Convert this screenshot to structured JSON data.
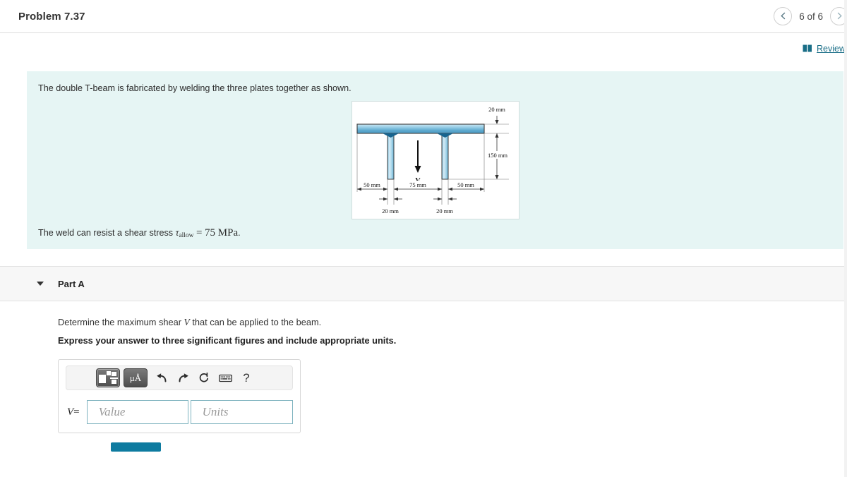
{
  "header": {
    "title": "Problem 7.37",
    "prev_icon": "chevron-left-icon",
    "next_icon": "chevron-right-icon",
    "pager_label": "6 of 6"
  },
  "review": {
    "icon": "book-icon",
    "label": "Review"
  },
  "statement": {
    "line1": "The double T-beam is fabricated by welding the three plates together as shown.",
    "line2_prefix": "The weld can resist a shear stress ",
    "line2_var": "τ",
    "line2_sub": "allow",
    "line2_eq": "=",
    "line2_value": "75 MPa",
    "line2_suffix": "."
  },
  "figure": {
    "caption_top": "20 mm",
    "caption_height": "150 mm",
    "dim_left": "50 mm",
    "dim_mid": "75 mm",
    "dim_right": "50 mm",
    "dim_web_left": "20 mm",
    "dim_web_right": "20 mm",
    "load_label": "V",
    "colors": {
      "flange_light": "#bfe0ef",
      "flange_mid": "#5fa9cf",
      "web_light": "#cfe6f2",
      "weld_dark": "#1a6a96",
      "outline": "#3b3b3b"
    }
  },
  "part": {
    "caret_icon": "chevron-down-icon",
    "label": "Part A",
    "question_prefix": "Determine the maximum shear ",
    "question_var": "V",
    "question_suffix": " that can be applied to the beam.",
    "instruction": "Express your answer to three significant figures and include appropriate units."
  },
  "answer": {
    "toolbar": [
      {
        "name": "template-button",
        "kind": "template",
        "label": ""
      },
      {
        "name": "units-button",
        "kind": "mu",
        "label": "μÅ"
      },
      {
        "name": "undo-icon",
        "kind": "icon",
        "label": "↩"
      },
      {
        "name": "redo-icon",
        "kind": "icon",
        "label": "↪"
      },
      {
        "name": "reset-icon",
        "kind": "icon",
        "label": "↺"
      },
      {
        "name": "keyboard-icon",
        "kind": "icon",
        "label": "⌨"
      },
      {
        "name": "help-icon",
        "kind": "icon",
        "label": "?"
      }
    ],
    "variable": "V",
    "equals": "=",
    "value_placeholder": "Value",
    "units_placeholder": "Units",
    "value": "",
    "units": ""
  },
  "submit": {
    "accent_color": "#0e7ba0"
  }
}
